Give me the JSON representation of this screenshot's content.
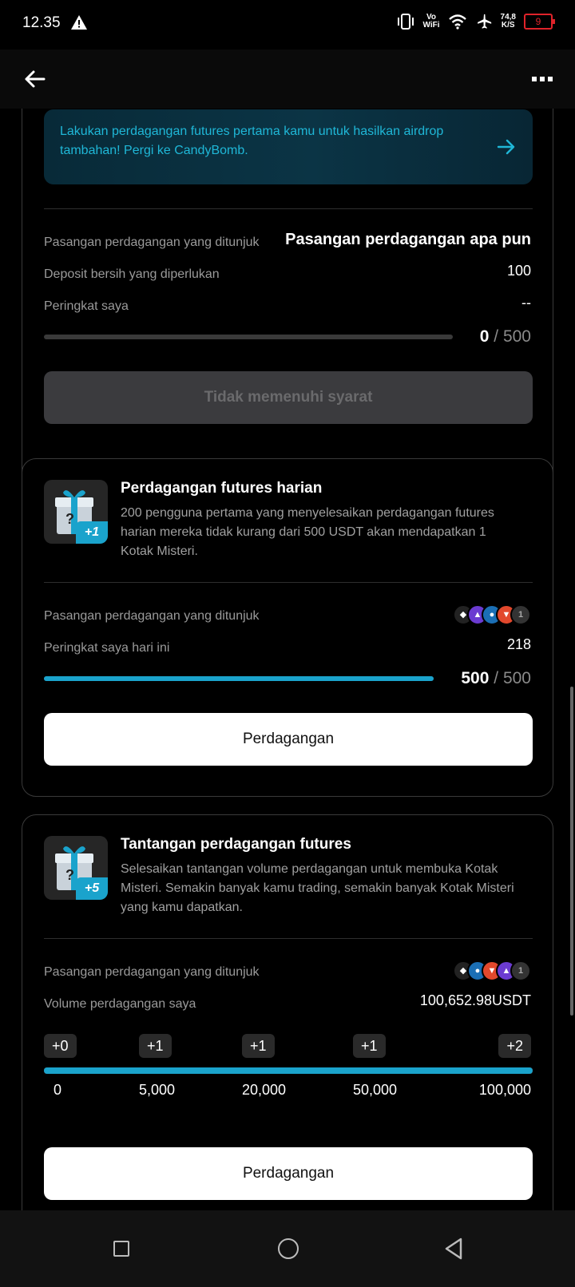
{
  "status_bar": {
    "time": "12.35",
    "vowifi_top": "Vo",
    "vowifi_bottom": "WiFi",
    "speed_top": "74,8",
    "speed_bottom": "K/S",
    "battery": "9",
    "battery_color": "#e0232a"
  },
  "header": {
    "back_icon": "arrow-left-icon",
    "more_icon": "more-icon"
  },
  "card1": {
    "banner_text": "Lakukan perdagangan futures pertama kamu untuk hasilkan airdrop tambahan! Pergi ke CandyBomb.",
    "rows": [
      {
        "label": "Pasangan perdagangan yang ditunjuk",
        "value": "Pasangan perdagangan apa pun"
      },
      {
        "label": "Deposit bersih yang diperlukan",
        "value": "100"
      },
      {
        "label": "Peringkat saya",
        "value": "--"
      }
    ],
    "progress": {
      "current": "0",
      "separator": "/",
      "total": "500",
      "fraction": 0
    },
    "button_label": "Tidak memenuhi syarat"
  },
  "card2": {
    "badge": "+1",
    "title": "Perdagangan futures harian",
    "description": "200 pengguna pertama yang menyelesaikan perdagangan futures harian mereka tidak kurang dari 500 USDT akan mendapatkan 1 Kotak Misteri.",
    "rows": [
      {
        "label": "Pasangan perdagangan yang ditunjuk"
      },
      {
        "label": "Peringkat saya hari ini",
        "value": "218"
      }
    ],
    "coin_overflow": "1",
    "progress": {
      "current": "500",
      "separator": "/",
      "total": "500",
      "fraction": 1
    },
    "button_label": "Perdagangan"
  },
  "card3": {
    "badge": "+5",
    "title": "Tantangan perdagangan futures",
    "description": "Selesaikan tantangan volume perdagangan untuk membuka Kotak Misteri. Semakin banyak kamu trading, semakin banyak Kotak Misteri yang kamu dapatkan.",
    "rows": [
      {
        "label": "Pasangan perdagangan yang ditunjuk"
      },
      {
        "label": "Volume perdagangan saya",
        "value": "100,652.98USDT"
      }
    ],
    "coin_overflow": "1",
    "milestones": [
      {
        "reward": "+0",
        "threshold": "0"
      },
      {
        "reward": "+1",
        "threshold": "5,000"
      },
      {
        "reward": "+1",
        "threshold": "20,000"
      },
      {
        "reward": "+1",
        "threshold": "50,000"
      },
      {
        "reward": "+2",
        "threshold": "100,000"
      }
    ],
    "progress_fraction": 1,
    "button_label": "Perdagangan"
  },
  "colors": {
    "accent": "#1aa3cc",
    "banner_text": "#1fb7d7",
    "background": "#000000"
  }
}
